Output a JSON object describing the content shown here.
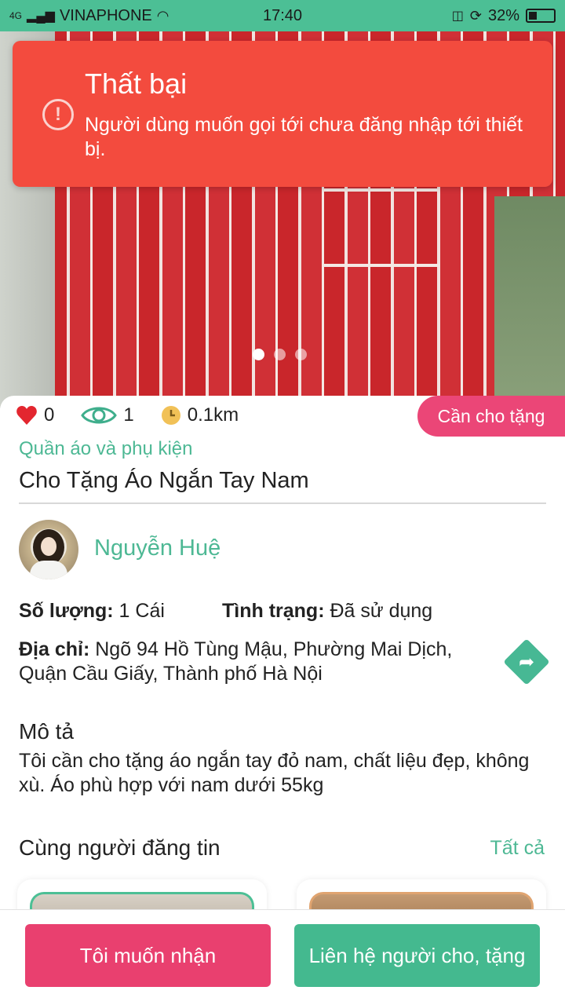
{
  "status_bar": {
    "network": "4G",
    "carrier": "VINAPHONE",
    "time": "17:40",
    "battery": "32%"
  },
  "toast": {
    "title": "Thất bại",
    "message": "Người dùng muốn gọi tới chưa đăng nhập tới thiết bị."
  },
  "gallery": {
    "page_count": 3,
    "active_index": 0
  },
  "stats": {
    "likes": "0",
    "views": "1",
    "distance": "0.1km"
  },
  "badge": "Cần cho tặng",
  "item": {
    "category": "Quần áo và phụ kiện",
    "title": "Cho Tặng Áo Ngắn Tay Nam"
  },
  "poster": {
    "name": "Nguyễn Huệ"
  },
  "details": {
    "quantity_label": "Số lượng:",
    "quantity_value": "1 Cái",
    "condition_label": "Tình trạng:",
    "condition_value": "Đã sử dụng",
    "address_label": "Địa chỉ:",
    "address_value": "Ngõ 94 Hồ Tùng Mậu, Phường Mai Dịch, Quận Cầu Giấy, Thành phố Hà Nội"
  },
  "description": {
    "title": "Mô tả",
    "text": "Tôi cần cho tặng áo ngắn tay đỏ nam, chất liệu đẹp, không xù. Áo phù hợp với nam dưới 55kg"
  },
  "related": {
    "title": "Cùng người đăng tin",
    "see_all": "Tất cả"
  },
  "actions": {
    "receive": "Tôi muốn nhận",
    "contact": "Liên hệ người cho, tặng"
  },
  "colors": {
    "accent_green": "#4db894",
    "accent_pink": "#e9406f",
    "toast_red": "#f34b3e"
  }
}
